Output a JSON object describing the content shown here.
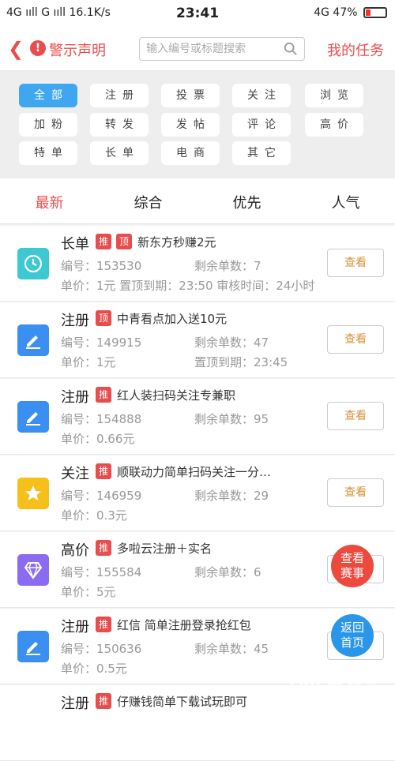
{
  "status": {
    "left": "4G ııll  G ııll  16.1K/s",
    "time": "23:41",
    "right": "4G  47%"
  },
  "header": {
    "warning_label": "警示声明",
    "search_placeholder": "输入编号或标题搜索",
    "my_tasks": "我的任务"
  },
  "filters": [
    "全部",
    "注册",
    "投票",
    "关注",
    "浏览",
    "加粉",
    "转发",
    "发帖",
    "评论",
    "高价",
    "特单",
    "长单",
    "电商",
    "其它"
  ],
  "sort_tabs": [
    "最新",
    "综合",
    "优先",
    "人气"
  ],
  "tasks": [
    {
      "category": "长单",
      "tags": [
        "推",
        "顶"
      ],
      "title": "新东方秒赚2元",
      "id_label": "编号：153530",
      "remain_label": "剩余单数：7",
      "line3": "单价：1元  置顶到期：23:50  审核时间：24小时",
      "line3b": "",
      "icon": "clock-icon",
      "icon_color": "#3ec8d2",
      "button": "查看"
    },
    {
      "category": "注册",
      "tags": [
        "顶"
      ],
      "title": "中青看点加入送10元",
      "id_label": "编号：149915",
      "remain_label": "剩余单数：47",
      "line3": "单价：1元",
      "line3b": "置顶到期：23:45",
      "icon": "pencil-icon",
      "icon_color": "#3a8ff0",
      "button": "查看"
    },
    {
      "category": "注册",
      "tags": [
        "推"
      ],
      "title": "红人装扫码关注专兼职",
      "id_label": "编号：154888",
      "remain_label": "剩余单数：95",
      "line3": "单价：0.66元",
      "line3b": "",
      "icon": "pencil-icon",
      "icon_color": "#3a8ff0",
      "button": "查看"
    },
    {
      "category": "关注",
      "tags": [
        "推"
      ],
      "title": "顺联动力简单扫码关注一分…",
      "id_label": "编号：146959",
      "remain_label": "剩余单数：29",
      "line3": "单价：0.3元",
      "line3b": "",
      "icon": "star-icon",
      "icon_color": "#f5c019",
      "button": "查看"
    },
    {
      "category": "高价",
      "tags": [
        "推"
      ],
      "title": "多啦云注册＋实名",
      "id_label": "编号：155584",
      "remain_label": "剩余单数：6",
      "line3": "单价：5元",
      "line3b": "",
      "icon": "diamond-icon",
      "icon_color": "#8b6cf0",
      "button": "查看"
    },
    {
      "category": "注册",
      "tags": [
        "推"
      ],
      "title": "红信 简单注册登录抢红包",
      "id_label": "编号：150636",
      "remain_label": "剩余单数：45",
      "line3": "单价：0.5元",
      "line3b": "",
      "icon": "pencil-icon",
      "icon_color": "#3a8ff0",
      "button": "查看"
    },
    {
      "category": "注册",
      "tags": [
        "推"
      ],
      "title": "仔赚钱简单下载试玩即可",
      "id_label": "",
      "remain_label": "",
      "line3": "",
      "line3b": "",
      "icon": "pencil-icon",
      "icon_color": "#3a8ff0",
      "button": ""
    }
  ],
  "float_buttons": {
    "view_race": [
      "查看",
      "赛事"
    ],
    "back_home": [
      "返回",
      "首页"
    ]
  },
  "watermark": "Bai 经验"
}
